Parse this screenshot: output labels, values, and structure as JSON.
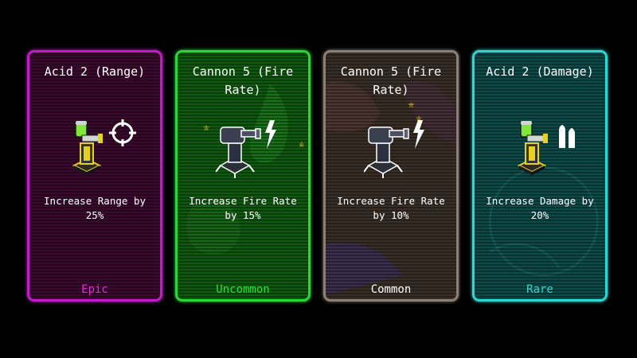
{
  "cards": [
    {
      "title": "Acid 2 (Range)",
      "description": "Increase Range by 25%",
      "rarity": "Epic",
      "tower_icon": "acid-tower-icon",
      "badge_icon": "crosshair-icon",
      "border_color": "#c21bcc",
      "rarity_color": "#e02bd8"
    },
    {
      "title": "Cannon 5 (Fire Rate)",
      "description": "Increase Fire Rate by 15%",
      "rarity": "Uncommon",
      "tower_icon": "cannon-tower-icon",
      "badge_icon": "lightning-icon",
      "border_color": "#29d63a",
      "rarity_color": "#2ee03c"
    },
    {
      "title": "Cannon 5 (Fire Rate)",
      "description": "Increase Fire Rate by 10%",
      "rarity": "Common",
      "tower_icon": "cannon-tower-icon",
      "badge_icon": "lightning-icon",
      "border_color": "#8a8078",
      "rarity_color": "#ffffff"
    },
    {
      "title": "Acid 2 (Damage)",
      "description": "Increase Damage by 20%",
      "rarity": "Rare",
      "tower_icon": "acid-tower-icon",
      "badge_icon": "ammo-icon",
      "border_color": "#2fd6cf",
      "rarity_color": "#32d8d2"
    }
  ]
}
